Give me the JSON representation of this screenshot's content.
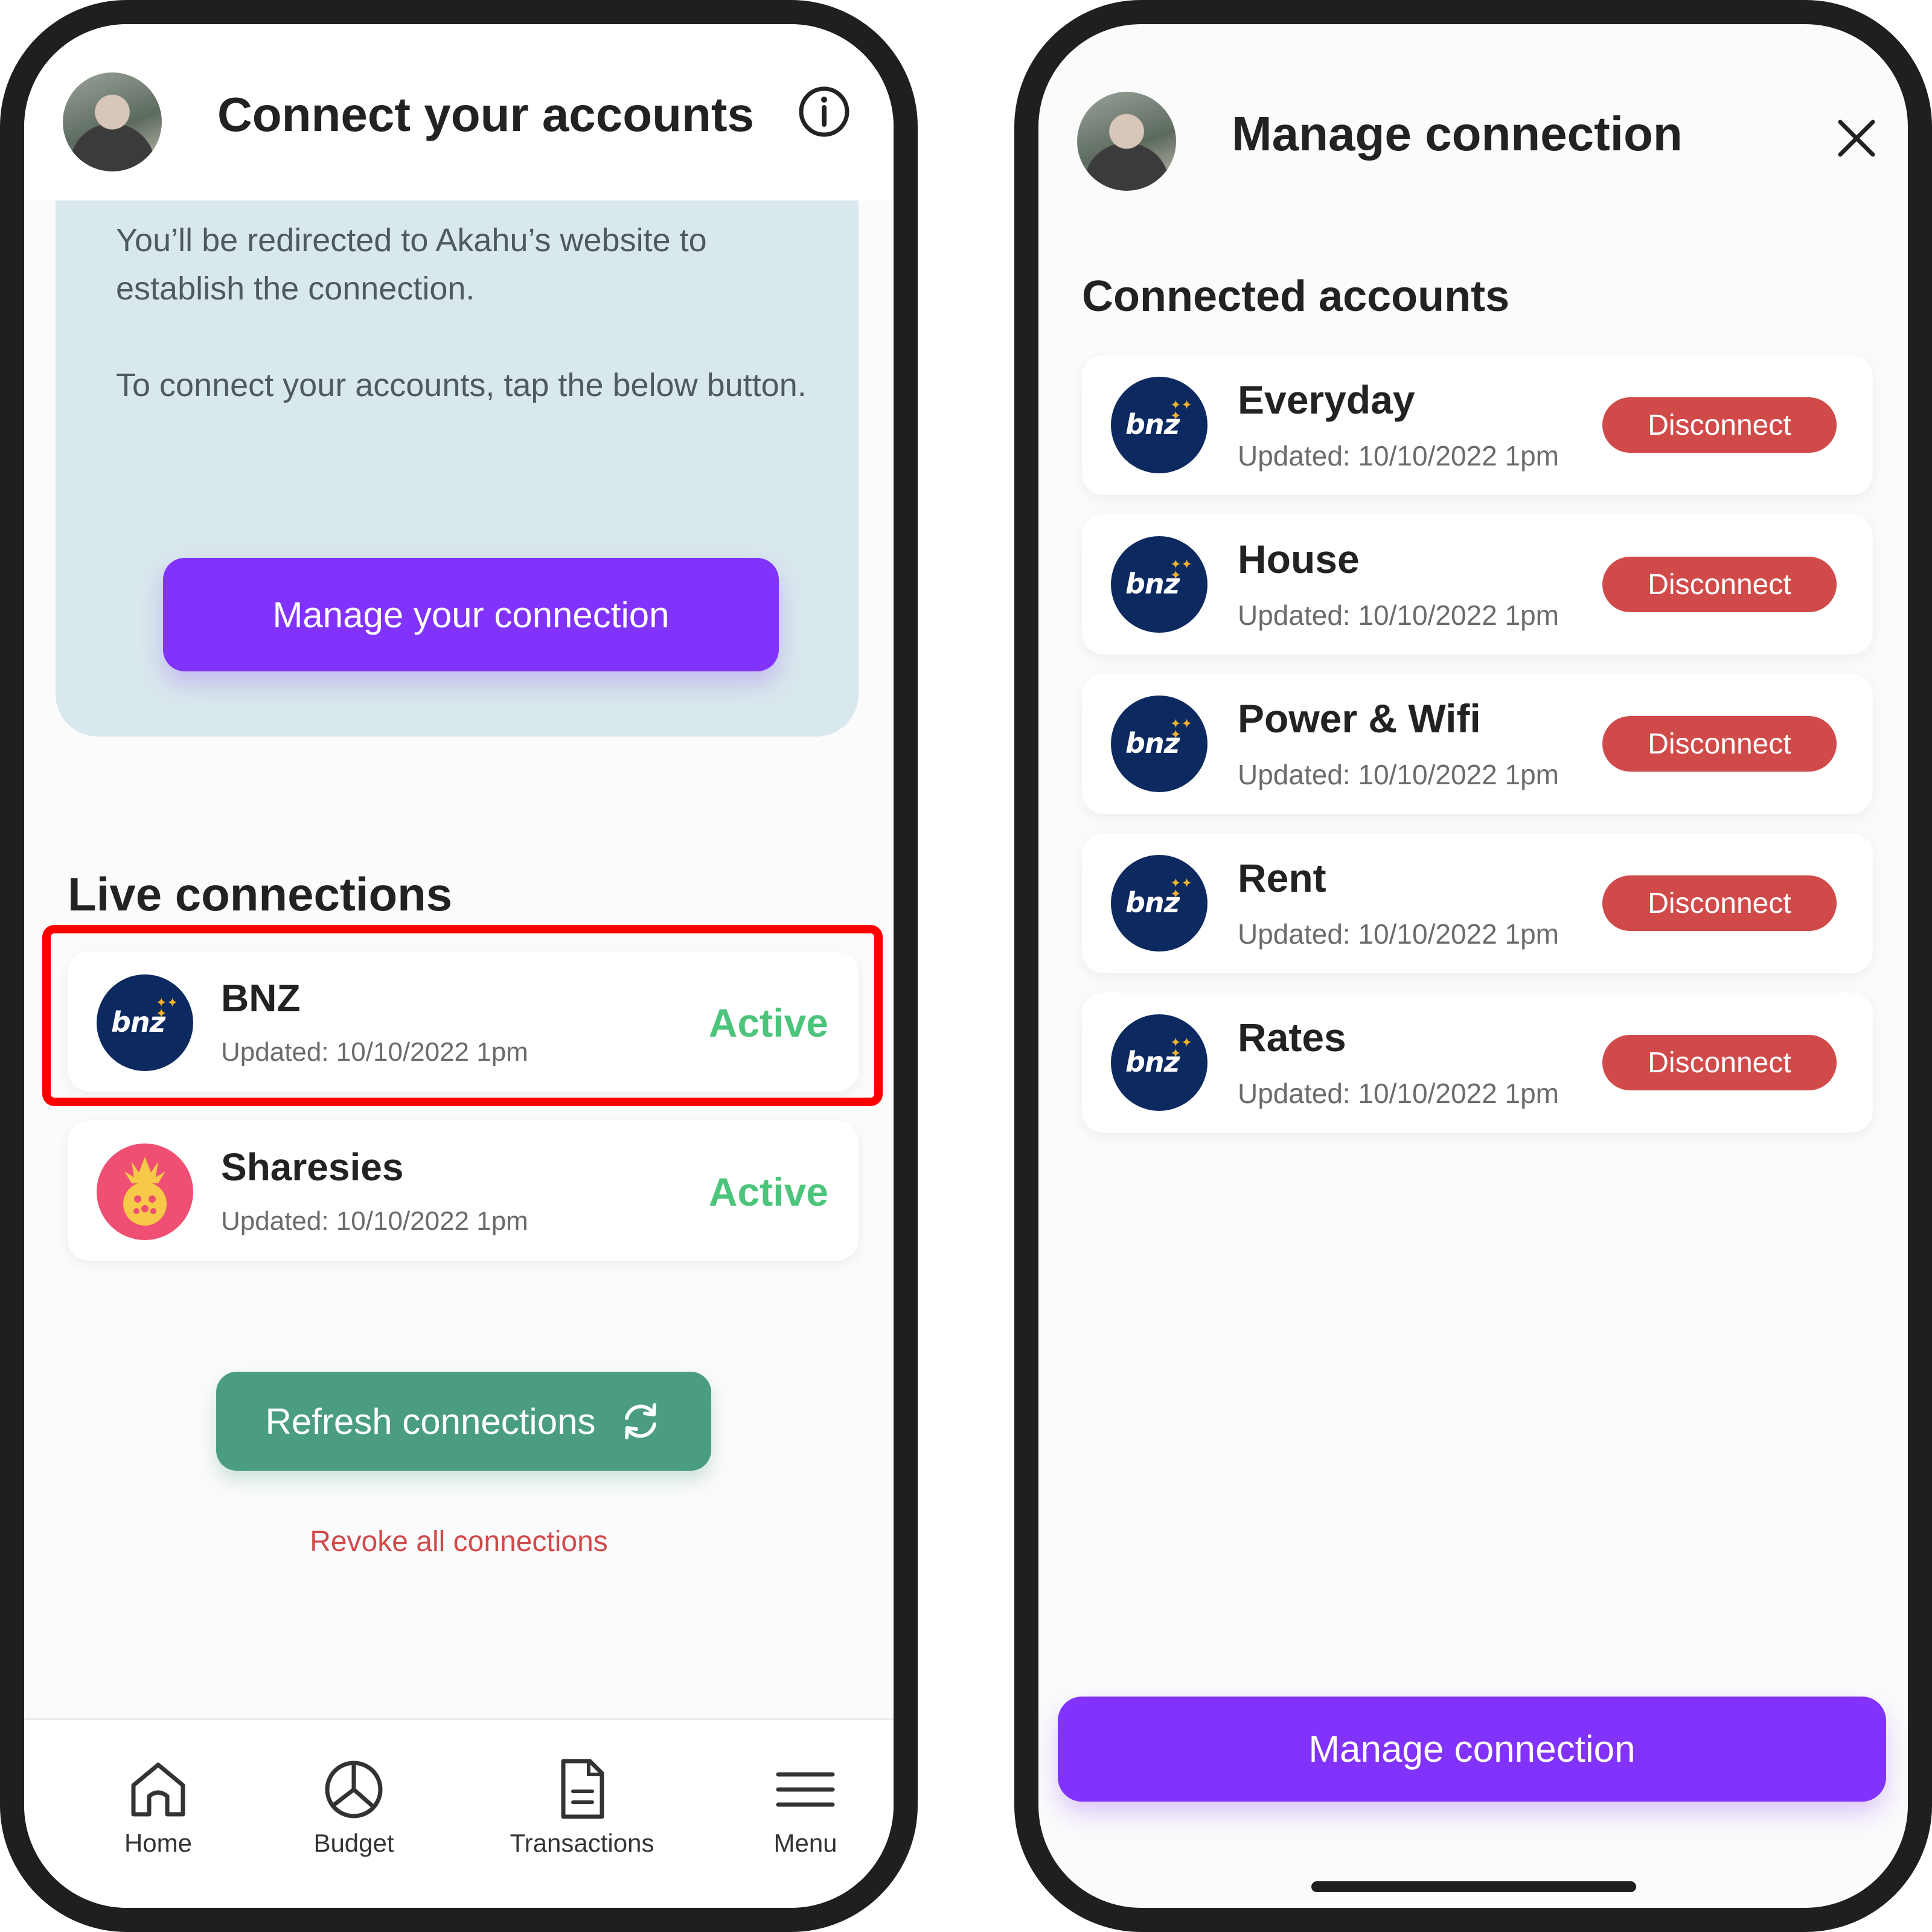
{
  "left": {
    "title": "Connect your accounts",
    "info_text_1": "You’ll be redirected to Akahu’s website to establish the connection.",
    "info_text_2": "To connect your accounts, tap the below button.",
    "manage_button": "Manage your connection",
    "section_title": "Live connections",
    "connections": [
      {
        "name": "BNZ",
        "updated": "Updated: 10/10/2022 1pm",
        "status": "Active",
        "logo_text": "bnz"
      },
      {
        "name": "Sharesies",
        "updated": "Updated: 10/10/2022 1pm",
        "status": "Active"
      }
    ],
    "refresh_button": "Refresh connections",
    "revoke_link": "Revoke all connections",
    "tabs": [
      {
        "label": "Home",
        "icon": "home-icon"
      },
      {
        "label": "Budget",
        "icon": "pie-chart-icon"
      },
      {
        "label": "Transactions",
        "icon": "document-icon"
      },
      {
        "label": "Menu",
        "icon": "hamburger-icon"
      }
    ]
  },
  "right": {
    "title": "Manage connection",
    "section_title": "Connected accounts",
    "accounts": [
      {
        "name": "Everyday",
        "updated": "Updated: 10/10/2022 1pm",
        "action": "Disconnect",
        "logo_text": "bnz"
      },
      {
        "name": "House",
        "updated": "Updated: 10/10/2022 1pm",
        "action": "Disconnect",
        "logo_text": "bnz"
      },
      {
        "name": "Power & Wifi",
        "updated": "Updated: 10/10/2022 1pm",
        "action": "Disconnect",
        "logo_text": "bnz"
      },
      {
        "name": "Rent",
        "updated": "Updated: 10/10/2022 1pm",
        "action": "Disconnect",
        "logo_text": "bnz"
      },
      {
        "name": "Rates",
        "updated": "Updated: 10/10/2022 1pm",
        "action": "Disconnect",
        "logo_text": "bnz"
      }
    ],
    "manage_button": "Manage connection"
  },
  "colors": {
    "primary_purple": "#8233fb",
    "active_green": "#4cc47b",
    "refresh_green": "#4a9d83",
    "danger_red": "#d14a4a",
    "bnz_navy": "#0c2960",
    "highlight_red": "#ff0000"
  }
}
